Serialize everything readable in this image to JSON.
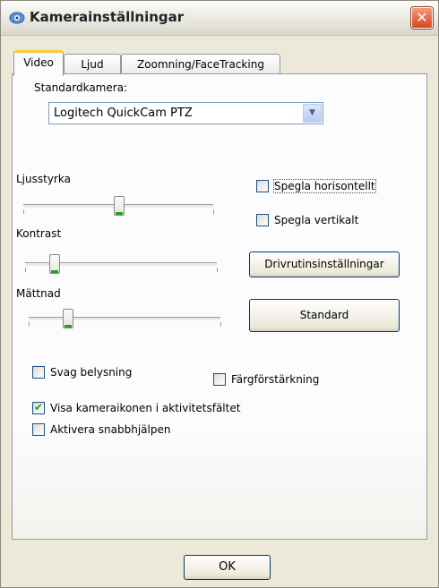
{
  "window": {
    "title": "Kamerainställningar",
    "close_glyph": "✕"
  },
  "tabs": [
    {
      "label": "Video",
      "selected": true
    },
    {
      "label": "Ljud",
      "selected": false
    },
    {
      "label": "Zoomning/FaceTracking",
      "selected": false
    }
  ],
  "video": {
    "camera_label": "Standardkamera:",
    "camera_value": "Logitech QuickCam PTZ",
    "sliders": [
      {
        "label": "Ljusstyrka",
        "value_fraction": 0.5
      },
      {
        "label": "Kontrast",
        "value_fraction": 0.15
      },
      {
        "label": "Mättnad",
        "value_fraction": 0.2
      }
    ],
    "mirror_horizontal": {
      "label": "Spegla horisontellt",
      "checked": false
    },
    "mirror_vertical": {
      "label": "Spegla vertikalt",
      "checked": false
    },
    "driver_button": "Drivrutinsinställningar",
    "standard_button": "Standard",
    "low_light": {
      "label": "Svag belysning",
      "checked": false
    },
    "color_boost": {
      "label": "Färgförstärkning",
      "checked": false
    },
    "show_tray_icon": {
      "label": "Visa kameraikonen i aktivitetsfältet",
      "checked": true
    },
    "enable_quick_help": {
      "label": "Aktivera snabbhjälpen",
      "checked": false
    }
  },
  "footer": {
    "ok_label": "OK"
  },
  "colors": {
    "accent_tab": "#ffc83c",
    "check_green": "#21a121",
    "close_red": "#d9431f"
  }
}
